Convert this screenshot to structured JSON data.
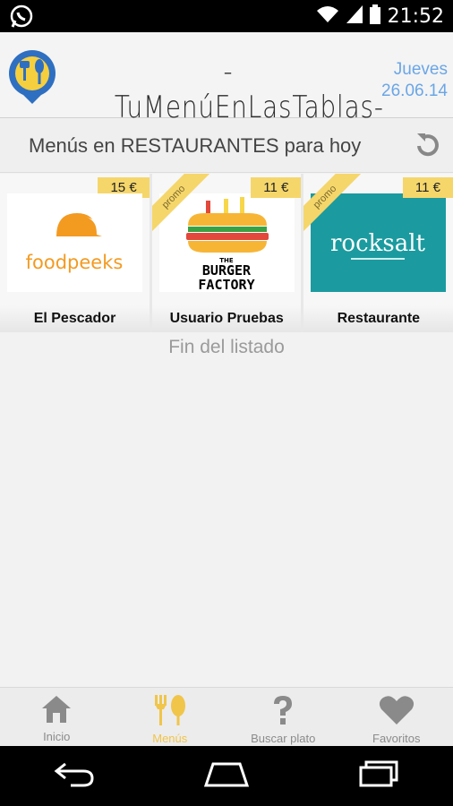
{
  "status_bar": {
    "time": "21:52",
    "icons": [
      "whatsapp-icon",
      "wifi-icon",
      "signal-icon",
      "battery-icon"
    ]
  },
  "header": {
    "brand": "-TuMenúEnLasTablas-",
    "day": "Jueves",
    "date": "26.06.14"
  },
  "subheader": {
    "title": "Menús en RESTAURANTES para hoy"
  },
  "restaurants": [
    {
      "name": "El Pescador",
      "price": "15 €",
      "promo": "",
      "logo_text": "foodpeeks"
    },
    {
      "name": "Usuario Pruebas",
      "price": "11 €",
      "promo": "promo",
      "logo_text_top": "THE",
      "logo_text": "BURGER",
      "logo_text2": "FACTORY"
    },
    {
      "name": "Restaurante",
      "price": "11 €",
      "promo": "promo",
      "logo_text": "rocksalt"
    }
  ],
  "end_message": "Fin del listado",
  "bottom_nav": [
    {
      "label": "Inicio",
      "icon": "home-icon"
    },
    {
      "label": "Menús",
      "icon": "cutlery-icon",
      "active": true
    },
    {
      "label": "Buscar plato",
      "icon": "question-icon"
    },
    {
      "label": "Favoritos",
      "icon": "heart-icon"
    }
  ],
  "colors": {
    "accent": "#f5d66b",
    "date_blue": "#6aa6e6",
    "teal": "#1b9b9f",
    "orange": "#f39a21"
  }
}
